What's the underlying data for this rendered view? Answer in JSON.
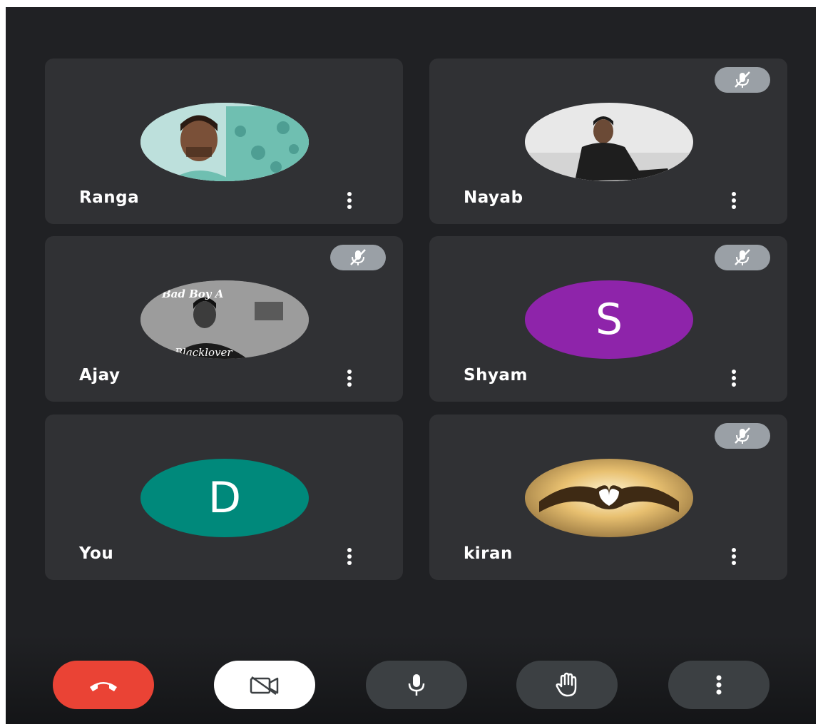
{
  "participants": [
    {
      "name": "Ranga",
      "avatar": "photo-man-floral-shirt-icon",
      "muted": false
    },
    {
      "name": "Nayab",
      "avatar": "photo-man-black-shirt-icon",
      "muted": true
    },
    {
      "name": "Ajay",
      "avatar": "photo-bad-boy-icon",
      "muted": true,
      "avatar_text_top": "Bad Boy A",
      "avatar_text_bottom": "Blacklover"
    },
    {
      "name": "Shyam",
      "avatar_letter": "S",
      "avatar_color": "#8e24aa",
      "muted": true
    },
    {
      "name": "You",
      "avatar_letter": "D",
      "avatar_color": "#00897b",
      "muted": false
    },
    {
      "name": "kiran",
      "avatar": "photo-heart-hands-icon",
      "muted": true
    }
  ],
  "controls": {
    "end_call": {
      "icon": "hang-up-icon",
      "color": "#ea4335"
    },
    "camera": {
      "icon": "camera-off-icon",
      "color": "#ffffff"
    },
    "microphone": {
      "icon": "microphone-icon"
    },
    "raise_hand": {
      "icon": "hand-icon"
    },
    "more": {
      "icon": "more-vert-icon"
    }
  },
  "colors": {
    "background": "#202124",
    "tile": "#303134",
    "muted_badge": "#9aa0a6",
    "control_dark": "#3c4043"
  }
}
